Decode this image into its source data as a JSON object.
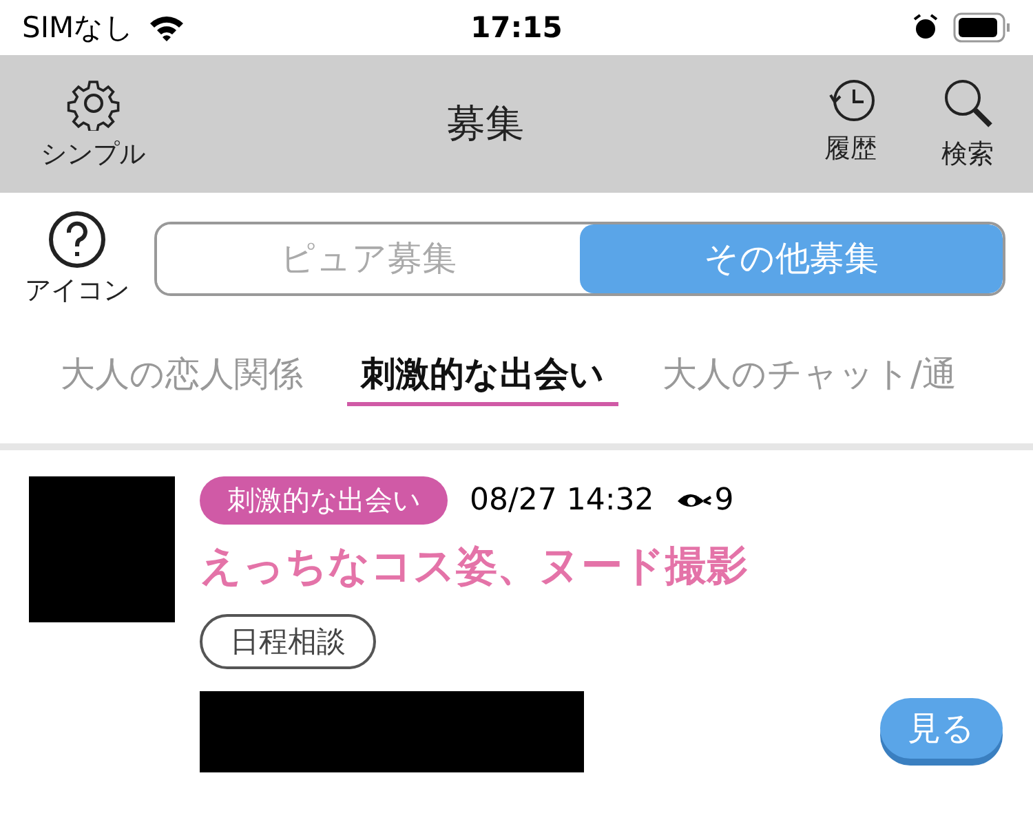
{
  "status_bar": {
    "carrier": "SIMなし",
    "time": "17:15"
  },
  "header": {
    "left": {
      "label": "シンプル"
    },
    "title": "募集",
    "right": [
      {
        "kind": "history",
        "label": "履歴"
      },
      {
        "kind": "search",
        "label": "検索"
      }
    ]
  },
  "help": {
    "label": "アイコン"
  },
  "segments": [
    {
      "label": "ピュア募集",
      "selected": false
    },
    {
      "label": "その他募集",
      "selected": true
    }
  ],
  "categories": [
    {
      "label": "大人の恋人関係",
      "selected": false
    },
    {
      "label": "刺激的な出会い",
      "selected": true
    },
    {
      "label": "大人のチャット/通",
      "selected": false
    }
  ],
  "posts": [
    {
      "category": "刺激的な出会い",
      "date": "08/27 14:32",
      "views": "9",
      "title": "えっちなコス姿、ヌード撮影",
      "tag": "日程相談",
      "button": "見る"
    }
  ]
}
